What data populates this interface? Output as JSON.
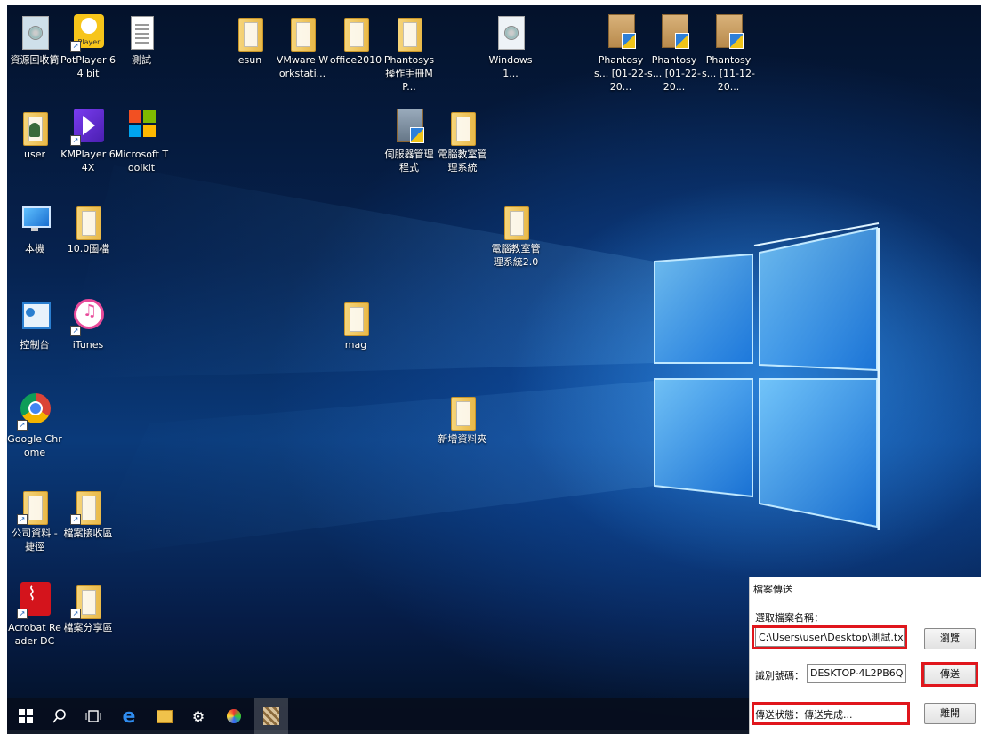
{
  "desktop_icons": [
    {
      "label": "資源回收筒",
      "type": "recycle"
    },
    {
      "label": "PotPlayer 64 bit",
      "type": "potplayer",
      "badge": "Player"
    },
    {
      "label": "測試",
      "type": "doc"
    },
    {
      "label": "esun",
      "type": "folder"
    },
    {
      "label": "VMware Workstati...",
      "type": "folder"
    },
    {
      "label": "office2010",
      "type": "folder"
    },
    {
      "label": "Phantosys操作手冊MP...",
      "type": "folder"
    },
    {
      "label": "Windows1...",
      "type": "disc"
    },
    {
      "label": "Phantosys... [01-22-20...",
      "type": "box"
    },
    {
      "label": "Phantosys... [01-22-20...",
      "type": "box"
    },
    {
      "label": "Phantosys... [11-12-20...",
      "type": "box"
    },
    {
      "label": "user",
      "type": "user"
    },
    {
      "label": "KMPlayer 64X",
      "type": "kmplayer"
    },
    {
      "label": "Microsoft Toolkit",
      "type": "mstoolkit"
    },
    {
      "label": "伺服器管理程式",
      "type": "server"
    },
    {
      "label": "電腦教室管理系統",
      "type": "folder"
    },
    {
      "label": "本機",
      "type": "pc"
    },
    {
      "label": "10.0圖檔",
      "type": "folder"
    },
    {
      "label": "電腦教室管理系統2.0",
      "type": "folder"
    },
    {
      "label": "控制台",
      "type": "control"
    },
    {
      "label": "iTunes",
      "type": "itunes"
    },
    {
      "label": "mag",
      "type": "folder"
    },
    {
      "label": "Google Chrome",
      "type": "chrome"
    },
    {
      "label": "新增資料夾",
      "type": "folder"
    },
    {
      "label": "公司資料 - 捷徑",
      "type": "folder"
    },
    {
      "label": "檔案接收區",
      "type": "folder"
    },
    {
      "label": "Acrobat Reader DC",
      "type": "acrobat"
    },
    {
      "label": "檔案分享區",
      "type": "folder"
    }
  ],
  "dialog": {
    "title": "檔案傳送",
    "select_label": "選取檔案名稱：",
    "path_value": "C:\\Users\\user\\Desktop\\測試.txt",
    "browse_button": "瀏覽",
    "id_label": "識別號碼：",
    "id_value": "DESKTOP-4L2PB6Q",
    "send_button": "傳送",
    "status_text": "傳送狀態：傳送完成...",
    "close_button": "離開",
    "highlight_color": "#e0161c"
  },
  "taskbar": {
    "items": [
      "windows-start-icon",
      "search-icon",
      "task-view-icon",
      "edge-icon",
      "file-explorer-icon",
      "settings-gear-icon",
      "paint-icon",
      "app-icon"
    ]
  }
}
